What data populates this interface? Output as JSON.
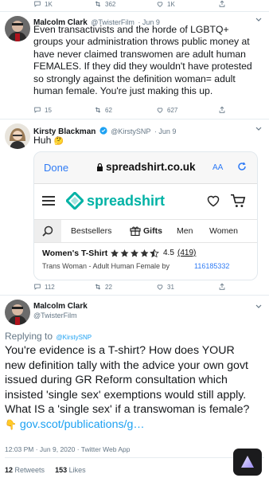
{
  "top_actions": {
    "replies": "1K",
    "retweets": "362",
    "likes": "1K"
  },
  "tweet1": {
    "name": "Malcolm Clark",
    "handle": "@TwisterFilm",
    "date": "· Jun 9",
    "text_lines": [
      "Even transactivists and the horde of LGBTQ+",
      "groups your administration throws public money at",
      "have never claimed transwomen are adult human",
      "FEMALES. If they did they wouldn't have protested",
      "so strongly against the definition woman= adult",
      "human female. You're just making this up."
    ],
    "replies": "15",
    "retweets": "62",
    "likes": "627"
  },
  "tweet2": {
    "name": "Kirsty Blackman",
    "handle": "@KirstySNP",
    "date": "· Jun 9",
    "text": "Huh",
    "emoji": "🤔",
    "replies": "112",
    "retweets": "22",
    "likes": "31",
    "card": {
      "done_label": "Done",
      "url": "spreadshirt.co.uk",
      "aa_label": "AA",
      "brand": "spreadshirt",
      "nav_items": [
        "Bestsellers",
        "Gifts",
        "Men",
        "Women"
      ],
      "product_title": "Women's T-Shirt",
      "rating": "4.5",
      "rating_count": "(419)",
      "product_desc": "Trans Woman - Adult Human Female by",
      "product_id": "116185332"
    }
  },
  "tweet3": {
    "name": "Malcolm Clark",
    "handle": "@TwisterFilm",
    "replying_prefix": "Replying to",
    "replying_to": "@KirstySNP",
    "text_lines": [
      "You're evidence is a T-shirt? How does YOUR",
      "new definition tally with the advice your own govt",
      "issued during GR Reform consultation which",
      "insisted 'single sex' exemptions would still apply.",
      "What IS a 'single sex' if a transwoman is female?"
    ],
    "link_emoji": "👇",
    "link": "gov.scot/publications/g…",
    "timestamp": "12:03 PM · Jun 9, 2020 · Twitter Web App",
    "retweets_count": "12",
    "retweets_label": "Retweets",
    "likes_count": "153",
    "likes_label": "Likes"
  },
  "colors": {
    "twitter_blue": "#1da1f2",
    "spreadshirt_teal": "#00b2a5",
    "verified": "#1da1f2",
    "star": "#333333"
  }
}
